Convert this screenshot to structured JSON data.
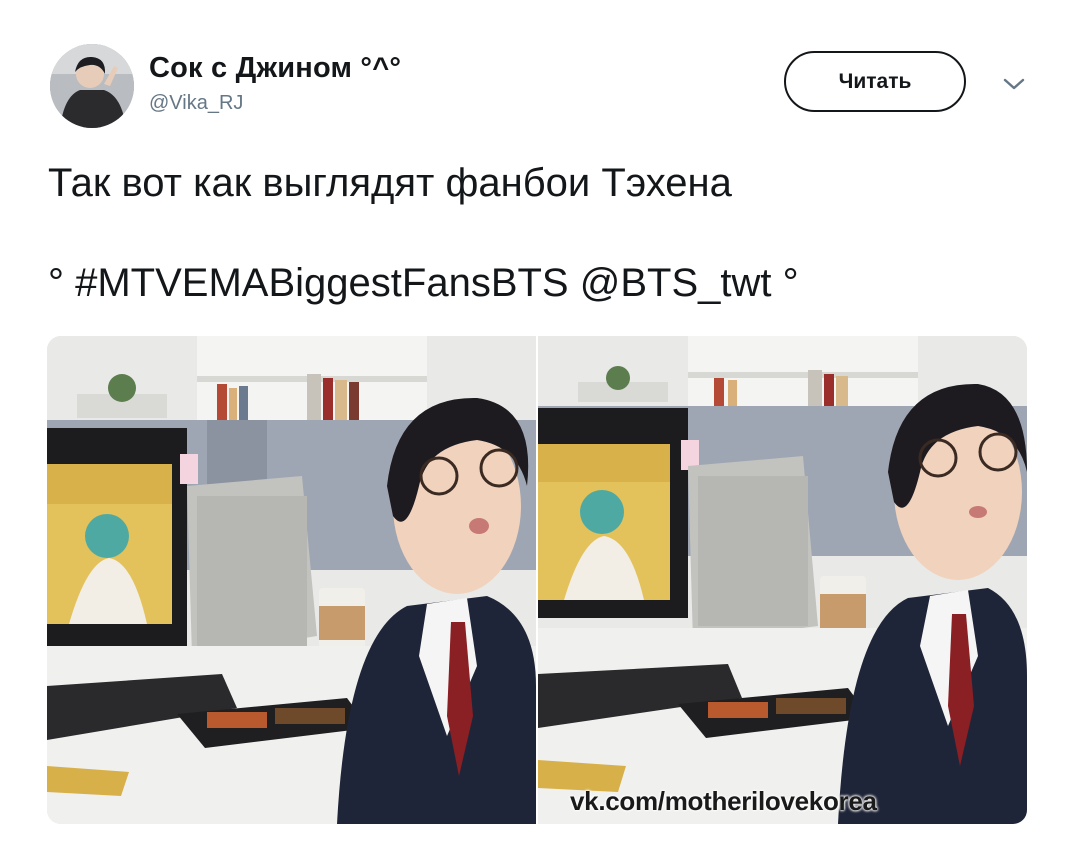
{
  "author": {
    "display_name": "Сок с Джином °^°",
    "handle": "@Vika_RJ",
    "avatar_icon": "user-avatar"
  },
  "actions": {
    "follow_label": "Читать",
    "more_icon": "chevron-down-icon"
  },
  "tweet": {
    "line1": "Так вот как выглядят фанбои Тэхена",
    "line2": "° #MTVEMABiggestFansBTS @BTS_twt °"
  },
  "media": {
    "watermark": "vk.com/motherilovekorea",
    "panel_count": 2
  },
  "colors": {
    "text_primary": "#14171a",
    "text_secondary": "#657786",
    "button_border": "#14171a"
  }
}
